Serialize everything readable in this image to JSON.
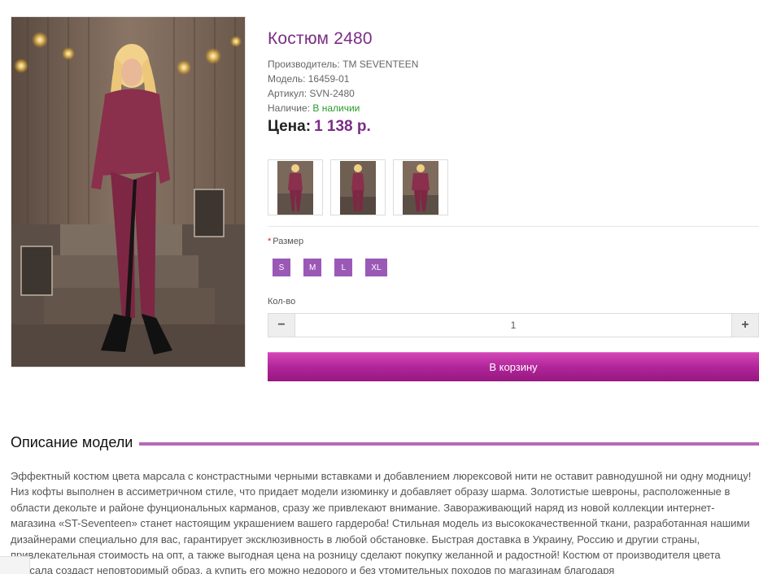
{
  "product": {
    "title": "Костюм 2480",
    "manufacturer_label": "Производитель:",
    "manufacturer": "ТМ SEVENTEEN",
    "model_label": "Модель:",
    "model": "16459-01",
    "article_label": "Артикул:",
    "article": "SVN-2480",
    "stock_label": "Наличие:",
    "stock": "В наличии",
    "price_label": "Цена:",
    "price": "1 138 р."
  },
  "thumbnails": [
    "thumb-1",
    "thumb-2",
    "thumb-3"
  ],
  "size": {
    "required_mark": "*",
    "label": "Размер",
    "options": [
      "S",
      "M",
      "L",
      "XL"
    ]
  },
  "quantity": {
    "label": "Кол-во",
    "value": "1",
    "minus": "−",
    "plus": "+"
  },
  "cart_button": "В корзину",
  "description": {
    "heading": "Описание модели",
    "text": "Эффектный костюм цвета марсала с констрастными черными вставками и добавлением люрексовой нити не оставит равнодушной ни одну модницу! Низ кофты выполнен в ассиметричном стиле, что придает модели изюминку и добавляет образу шарма. Золотистые шевроны, расположенные в области декольте и районе фунциональных карманов, сразу же привлекают внимание. Завораживающий наряд из новой коллекции интернет-магазина «ST-Seventeen» станет настоящим украшением вашего гардероба! Стильная модель из высококачественной ткани, разработанная нашими дизайнерами специально для вас, гарантирует эксклюзивность в любой обстановке. Быстрая доставка в Украину, Россию и другии страны, привлекательная стоимость на опт, а также выгодная цена на розницу сделают покупку желанной и радостной! Костюм от производителя цвета марсала создаст неповторимый образ, а купить его можно недорого и без утомительных походов по магазинам благодаря"
  },
  "colors": {
    "accent": "#7b2d85",
    "size_button": "#9b59b6",
    "cart_button": "#b1259a",
    "heading_line": "#b569b8",
    "stock": "#2a9a2a"
  }
}
